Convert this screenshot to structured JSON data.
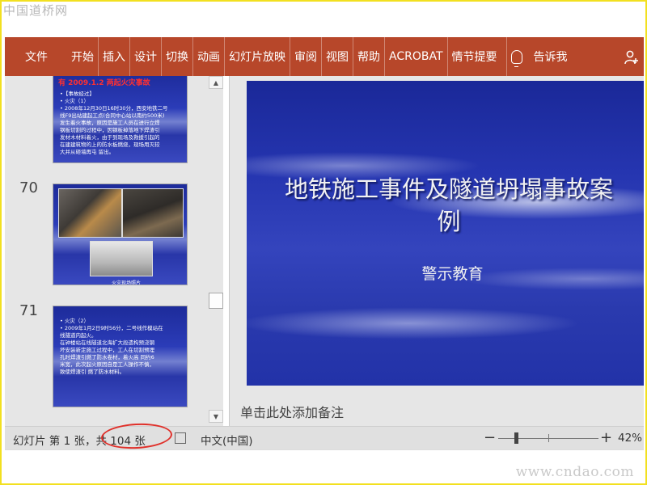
{
  "watermark": {
    "top": "中国道桥网",
    "bottom": "www.cndao.com"
  },
  "ribbon": {
    "file": "文件",
    "tabs": [
      "开始",
      "插入",
      "设计",
      "切换",
      "动画",
      "幻灯片放映",
      "审阅",
      "视图",
      "帮助",
      "ACROBAT",
      "情节提要"
    ],
    "tellme": "告诉我",
    "color": "#b7472a",
    "icons": {
      "tellme": "lightbulb-icon",
      "share": "add-person-icon"
    }
  },
  "thumbnails": [
    {
      "number": "",
      "heading": "有 2009.1.2 两起火灾事故",
      "lines": [
        "•【事故经过】",
        "• 火灾（1）",
        "• 2008年12月30日16时30分，西安地铁二号",
        "线F9出站建起工点(合同中心站以南约500米)",
        "发生着火事故，原因是施工人员在进行立焊",
        "钢板切割的过程中，因钢板掉落地下焊渣引",
        "发材木材料着火，由于到现场及救援引起的",
        "在建建筑物的上的防水板燃烧，现场用灭较",
        "大并从砸墙再屯 留出。"
      ]
    },
    {
      "number": "70",
      "caption": "火灾现场照片"
    },
    {
      "number": "71",
      "lines": [
        "• 火灾（2）",
        "• 2009年1月2日9时56分，二号线作模站在",
        "  线隧道内起火。",
        "  在钟楼站在线隧道北海扩大段遗构预浇钢",
        "  坏安装新定施工过程中，工人在切割预埋",
        "  孔时焊渣引燃了防水卷材，着火高 同约6",
        "  米宽，此次起火原因自是工人操作不慎，",
        "  致使焊渣引 燃了防水材料。"
      ]
    }
  ],
  "slide": {
    "title": "地铁施工事件及隧道坍塌事故案例",
    "subtitle": "警示教育"
  },
  "notes_placeholder": "单击此处添加备注",
  "status": {
    "slide_prefix": "幻灯片 第 1 张，",
    "slide_total": "共 104 张",
    "language": "中文(中国)",
    "zoom": "42%",
    "zoom_minus": "−",
    "zoom_plus": "+",
    "zoom_level": 0.42,
    "highlight_color": "#e0302a"
  }
}
